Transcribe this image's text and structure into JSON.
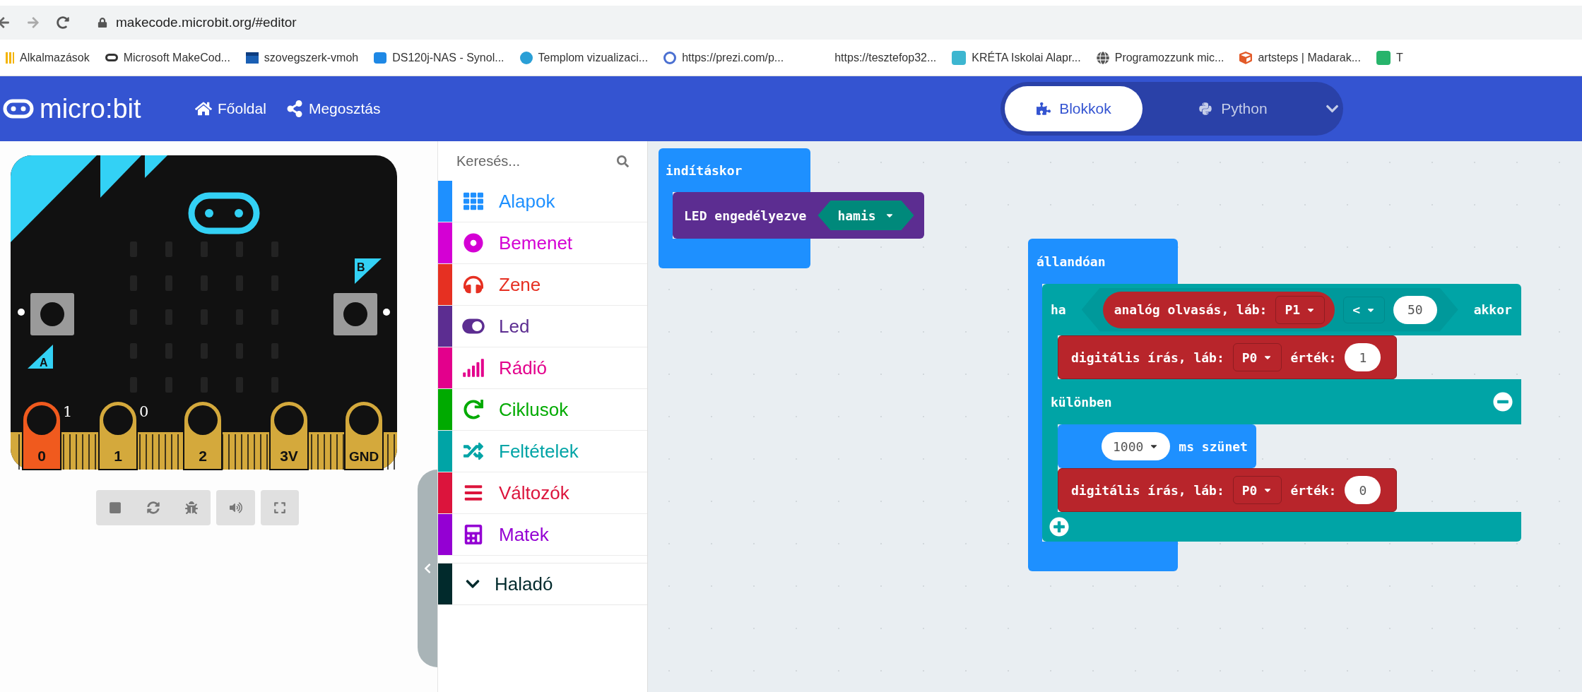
{
  "browser": {
    "url": "makecode.microbit.org/#editor",
    "bookmarks": [
      "Alkalmazások",
      "Microsoft MakeCod...",
      "szovegszerk-vmoh",
      "DS120j-NAS - Synol...",
      "Templom vizualizaci...",
      "https://prezi.com/p...",
      "https://tesztefop32...",
      "KRÉTA Iskolai Alapr...",
      "Programozzunk mic...",
      "artsteps | Madarak...",
      "T"
    ]
  },
  "header": {
    "logo": "micro:bit",
    "nav": [
      "Főoldal",
      "Megosztás"
    ],
    "editor_tabs": [
      {
        "label": "Blokkok",
        "selected": true
      },
      {
        "label": "Python",
        "selected": false
      }
    ]
  },
  "simulator": {
    "button_labels": [
      "A",
      "B"
    ],
    "pins": [
      {
        "label": "0",
        "active": true,
        "reading": "1"
      },
      {
        "label": "1",
        "active": false,
        "reading": "0"
      },
      {
        "label": "2",
        "active": false
      },
      {
        "label": "3V",
        "active": false
      },
      {
        "label": "GND",
        "active": false
      }
    ]
  },
  "toolbox": {
    "search": {
      "placeholder": "Keresés..."
    },
    "categories": [
      {
        "label": "Alapok",
        "color": "#1e90ff",
        "kind": "category"
      },
      {
        "label": "Bemenet",
        "color": "#d400d4",
        "kind": "category"
      },
      {
        "label": "Zene",
        "color": "#e63022",
        "kind": "category"
      },
      {
        "label": "Led",
        "color": "#5c2d91",
        "kind": "category"
      },
      {
        "label": "Rádió",
        "color": "#e3008c",
        "kind": "category"
      },
      {
        "label": "Ciklusok",
        "color": "#00aa00",
        "kind": "category"
      },
      {
        "label": "Feltételek",
        "color": "#00a4a6",
        "kind": "category"
      },
      {
        "label": "Változók",
        "color": "#dc143c",
        "kind": "category"
      },
      {
        "label": "Matek",
        "color": "#9400d3",
        "kind": "category"
      },
      {
        "label": "Haladó",
        "color": "#012a2c",
        "kind": "expander"
      }
    ]
  },
  "workspace": {
    "on_start": {
      "label": "indításkor",
      "body": [
        {
          "label": "LED engedélyezve",
          "value": "hamis"
        }
      ]
    },
    "forever": {
      "label": "állandóan",
      "if": {
        "label": "ha",
        "condition": {
          "reporter": "analóg olvasás, láb:",
          "pin": "P1",
          "operator": "<",
          "value": "50"
        },
        "then_label": "akkor",
        "then": [
          {
            "kind": "digital_write",
            "label": "digitális írás, láb:",
            "pin": "P0",
            "value_label": "érték:",
            "value": "1"
          }
        ],
        "else_label": "különben",
        "else": [
          {
            "kind": "pause",
            "value": "1000",
            "label": "ms szünet"
          },
          {
            "kind": "digital_write",
            "label": "digitális írás, láb:",
            "pin": "P0",
            "value_label": "érték:",
            "value": "0"
          }
        ]
      }
    }
  }
}
